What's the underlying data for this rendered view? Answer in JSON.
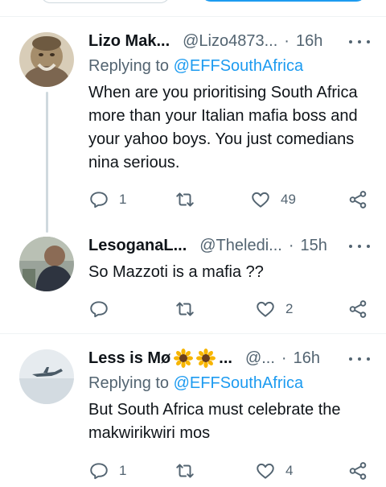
{
  "colors": {
    "accent": "#1d9bf0",
    "muted": "#536471",
    "text": "#0f1419",
    "divider": "#eff3f4"
  },
  "tweets": [
    {
      "display_name": "Lizo Mak...",
      "handle": "@Lizo4873...",
      "dot": "·",
      "time": "16h",
      "replying_prefix": "Replying to",
      "replying_to": "@EFFSouthAfrica",
      "text": "When are you prioritising South Africa more than your Italian mafia boss and your yahoo boys. You just comedians nina serious.",
      "replies": "1",
      "retweets": "",
      "likes": "49"
    },
    {
      "display_name": "LesoganaL...",
      "handle": "@Theledi...",
      "dot": "·",
      "time": "15h",
      "text": "So Mazzoti is a mafia ??",
      "replies": "",
      "retweets": "",
      "likes": "2"
    },
    {
      "display_name": "Less is Mø",
      "name_suffix": "...",
      "handle": "@...",
      "dot": "·",
      "time": "16h",
      "replying_prefix": "Replying to",
      "replying_to": "@EFFSouthAfrica",
      "text": "But South Africa must celebrate the makwirikwiri mos",
      "replies": "1",
      "retweets": "",
      "likes": "4"
    }
  ],
  "icons": [
    "reply-icon",
    "retweet-icon",
    "like-icon",
    "share-icon",
    "more-icon",
    "sunflower-emoji"
  ]
}
